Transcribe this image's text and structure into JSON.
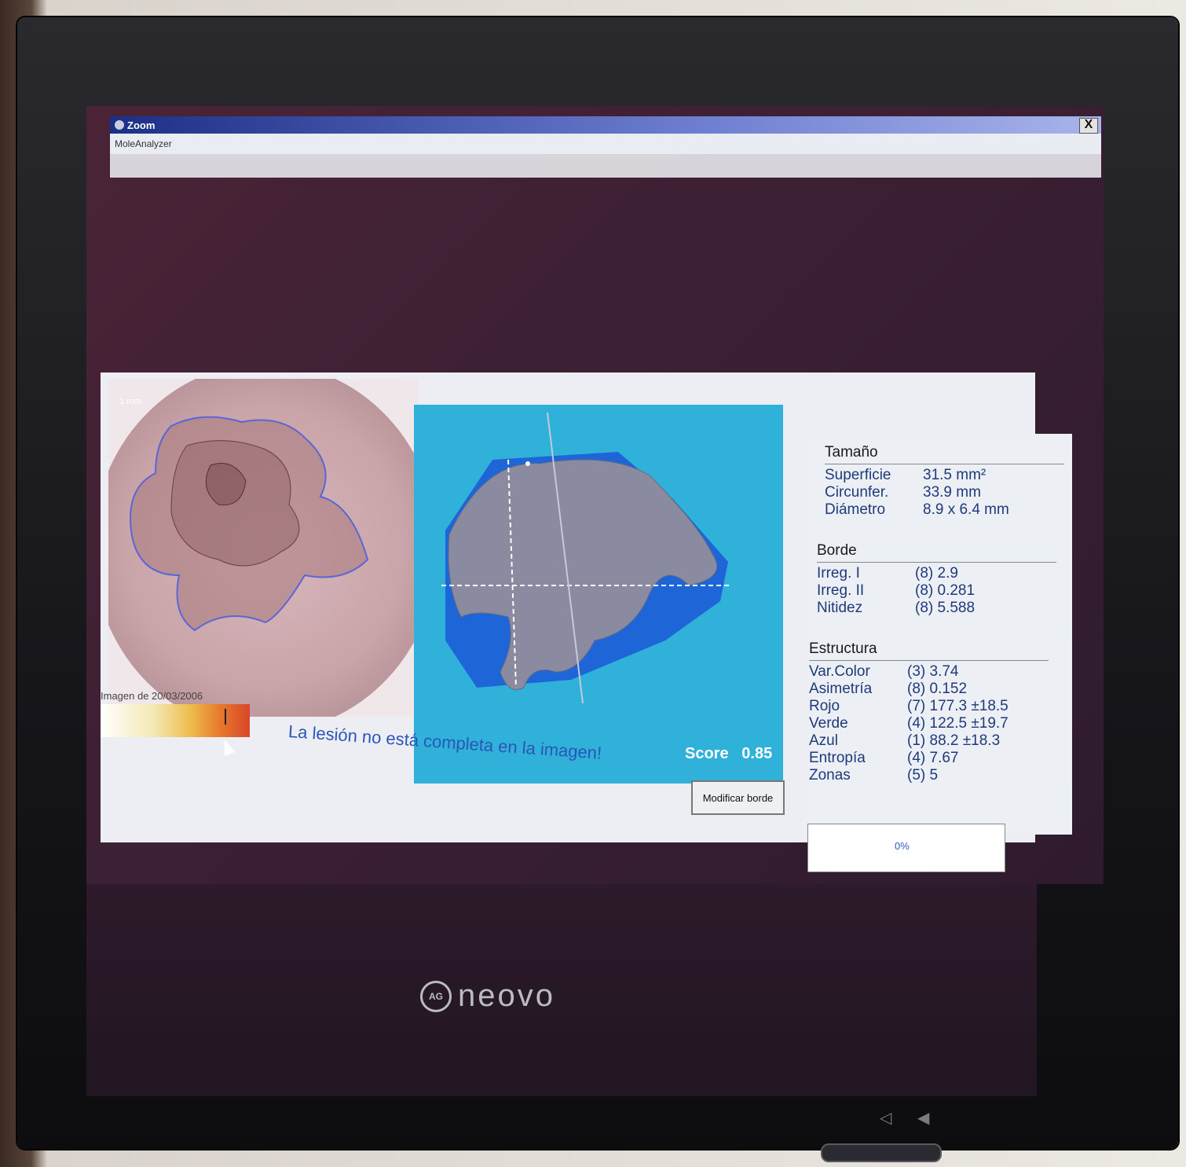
{
  "window": {
    "title": "Zoom",
    "subtitle": "MoleAnalyzer",
    "close_glyph": "X"
  },
  "left_image": {
    "scale_label": "1 mm",
    "caption": "Imagen de 20/03/2006"
  },
  "right_image": {
    "score_label": "Score",
    "score_value": "0.85"
  },
  "message": "La lesión no está completa en la imagen!",
  "modify_button": "Modificar borde",
  "tamano": {
    "title": "Tamaño",
    "rows": [
      {
        "label": "Superficie",
        "value": "31.5 mm²"
      },
      {
        "label": "Circunfer.",
        "value": "33.9 mm"
      },
      {
        "label": "Diámetro",
        "value": "8.9 x 6.4 mm"
      }
    ]
  },
  "borde": {
    "title": "Borde",
    "rows": [
      {
        "label": "Irreg. I",
        "value": "(8) 2.9"
      },
      {
        "label": "Irreg. II",
        "value": "(8) 0.281"
      },
      {
        "label": "Nitidez",
        "value": "(8) 5.588"
      }
    ]
  },
  "estructura": {
    "title": "Estructura",
    "rows": [
      {
        "label": "Var.Color",
        "value": "(3) 3.74"
      },
      {
        "label": "Asimetría",
        "value": "(8) 0.152"
      },
      {
        "label": "Rojo",
        "value": "(7) 177.3  ±18.5"
      },
      {
        "label": "Verde",
        "value": "(4) 122.5  ±19.7"
      },
      {
        "label": "Azul",
        "value": "(1) 88.2  ±18.3"
      },
      {
        "label": "Entropía",
        "value": "(4) 7.67"
      },
      {
        "label": "Zonas",
        "value": "(5) 5"
      }
    ]
  },
  "progress": {
    "label": "0%",
    "fraction": 0
  },
  "monitor": {
    "brand": "neovo",
    "logo": "AG"
  },
  "colors": {
    "title_bar": "#1c2f86",
    "message": "#2c55b8",
    "lesion_bg": "#2fb1d9"
  }
}
